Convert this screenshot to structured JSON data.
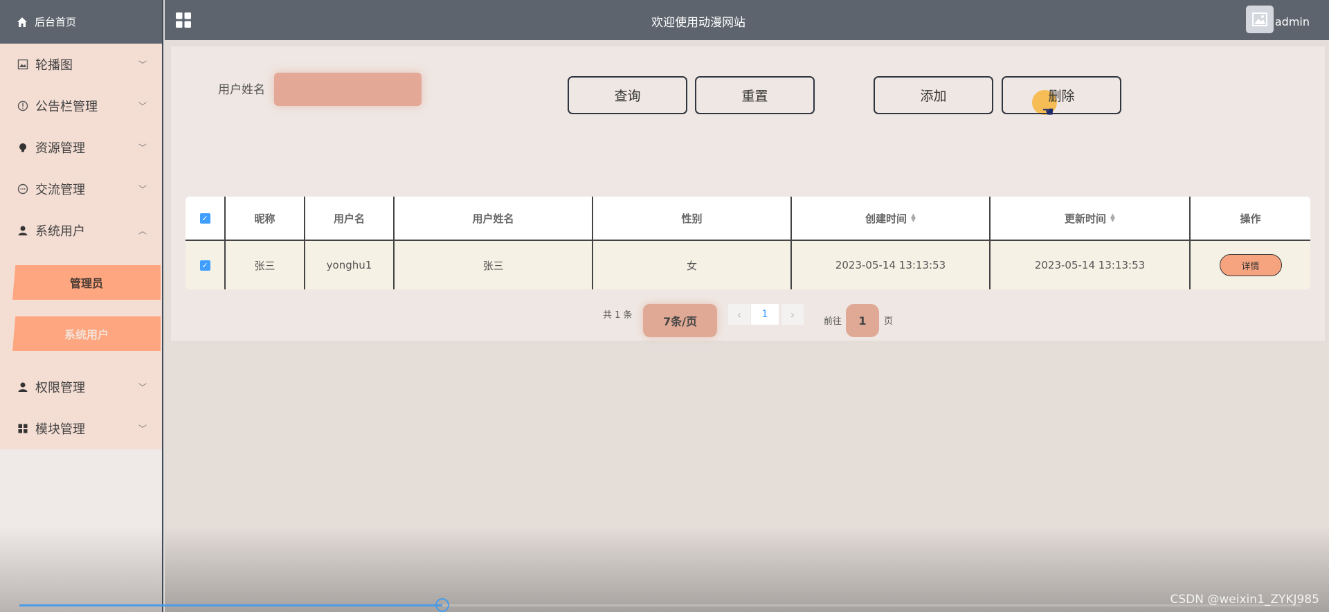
{
  "sidebar": {
    "home_label": "后台首页",
    "menu": [
      {
        "label": "轮播图",
        "icon": "image-icon"
      },
      {
        "label": "公告栏管理",
        "icon": "info-circle-icon"
      },
      {
        "label": "资源管理",
        "icon": "bulb-icon"
      },
      {
        "label": "交流管理",
        "icon": "chat-icon"
      },
      {
        "label": "系统用户",
        "icon": "user-icon"
      }
    ],
    "submenu": [
      {
        "label": "管理员"
      },
      {
        "label": "系统用户"
      }
    ],
    "menu_after": [
      {
        "label": "权限管理",
        "icon": "user-icon"
      },
      {
        "label": "模块管理",
        "icon": "grid-icon"
      }
    ]
  },
  "topbar": {
    "title": "欢迎使用动漫网站",
    "username": "admin"
  },
  "search": {
    "label": "用户姓名",
    "value": ""
  },
  "buttons": {
    "query": "查询",
    "reset": "重置",
    "add": "添加",
    "delete": "删除"
  },
  "table": {
    "headers": [
      "昵称",
      "用户名",
      "用户姓名",
      "性别",
      "创建时间",
      "更新时间",
      "操作"
    ],
    "rows": [
      {
        "nickname": "张三",
        "username": "yonghu1",
        "realname": "张三",
        "gender": "女",
        "created": "2023-05-14 13:13:53",
        "updated": "2023-05-14 13:13:53",
        "action": "详情"
      }
    ]
  },
  "pagination": {
    "total": "共 1 条",
    "page_size": "7条/页",
    "current": "1",
    "goto_label": "前往",
    "goto_value": "1",
    "page_suffix": "页"
  },
  "video_progress": 0.33,
  "watermark": "CSDN @weixin1_ZYKJ985",
  "colors": {
    "accent": "#fda67f",
    "header": "#5d646e",
    "checkbox": "#409eff"
  }
}
